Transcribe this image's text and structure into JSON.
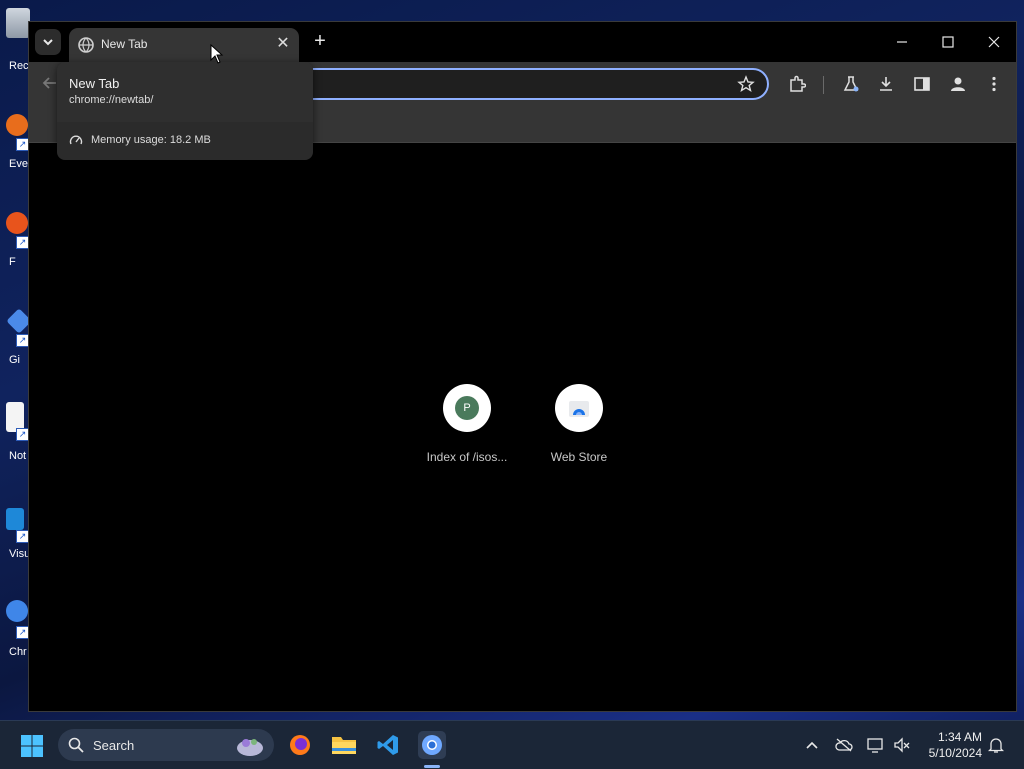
{
  "desktop": {
    "icons": [
      {
        "label": "Rec",
        "icon": "recycle-bin-icon"
      },
      {
        "label": "Eve",
        "icon": "everything-icon"
      },
      {
        "label": "F",
        "icon": "firefox-icon"
      },
      {
        "label": "Gi",
        "icon": "git-icon"
      },
      {
        "label": "Not",
        "icon": "notepad-icon"
      },
      {
        "label": "Visu",
        "icon": "vscode-icon"
      },
      {
        "label": "Chr",
        "icon": "chrome-icon"
      }
    ]
  },
  "browser": {
    "tab": {
      "title": "New Tab",
      "close": "✕"
    },
    "new_tab_symbol": "+",
    "window_controls": {
      "minimize": "—",
      "maximize": "☐",
      "close": "✕"
    },
    "hover_card": {
      "title": "New Tab",
      "url": "chrome://newtab/",
      "memory": "Memory usage: 18.2 MB"
    },
    "shortcuts": [
      {
        "label": "Index of /isos...",
        "initial": "P"
      },
      {
        "label": "Web Store",
        "initial": ""
      }
    ]
  },
  "taskbar": {
    "search_label": "Search",
    "clock_time": "1:34 AM",
    "clock_date": "5/10/2024"
  }
}
